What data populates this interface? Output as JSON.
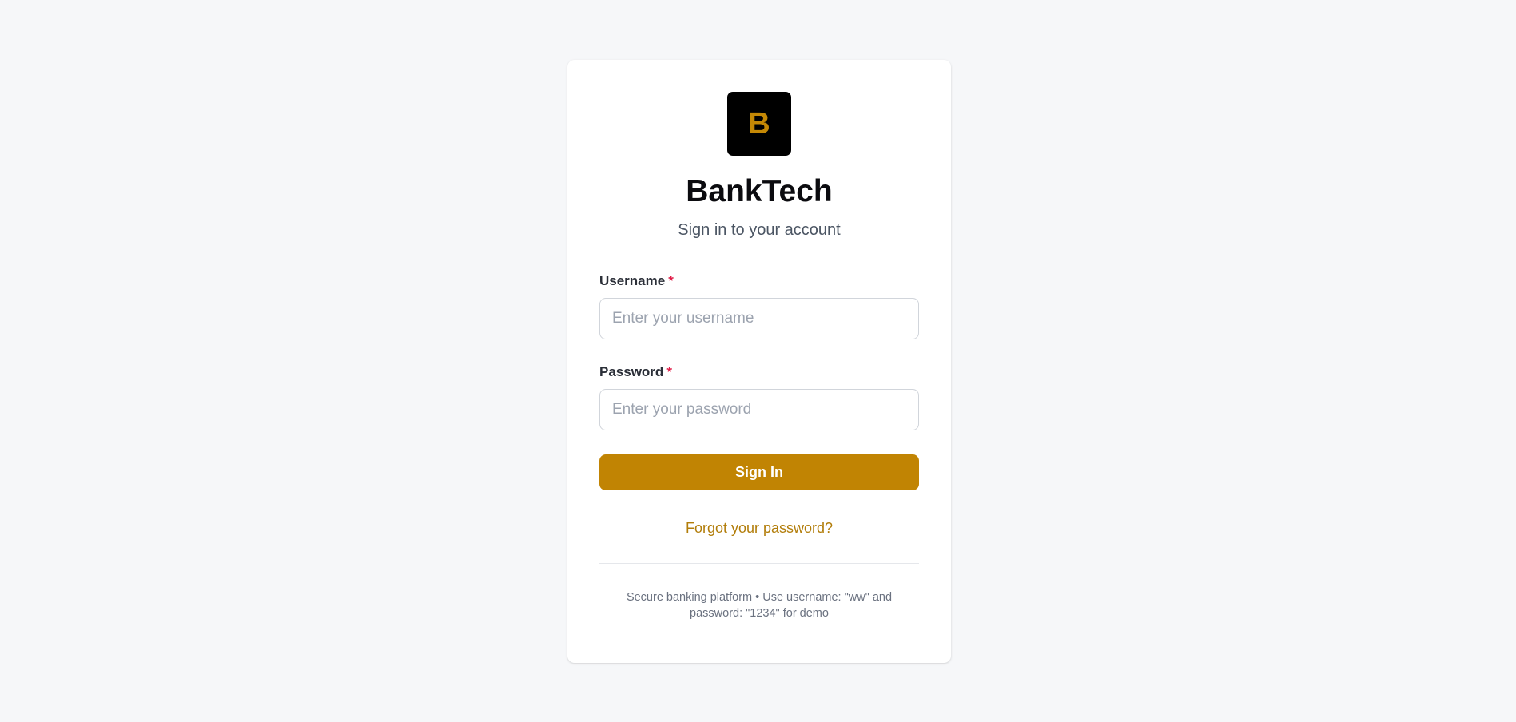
{
  "brand": {
    "logo_letter": "B",
    "name": "BankTech",
    "subtitle": "Sign in to your account"
  },
  "form": {
    "username": {
      "label": "Username",
      "required_mark": "*",
      "placeholder": "Enter your username",
      "value": ""
    },
    "password": {
      "label": "Password",
      "required_mark": "*",
      "placeholder": "Enter your password",
      "value": ""
    },
    "submit_label": "Sign In",
    "forgot_label": "Forgot your password?"
  },
  "footer": {
    "note": "Secure banking platform • Use username: \"ww\" and password: \"1234\" for demo"
  },
  "colors": {
    "accent": "#c18403",
    "logo_bg": "#000000",
    "logo_fg": "#c48805",
    "link": "#b27d0a",
    "required": "#e11d48",
    "page_bg": "#f6f7f9"
  }
}
